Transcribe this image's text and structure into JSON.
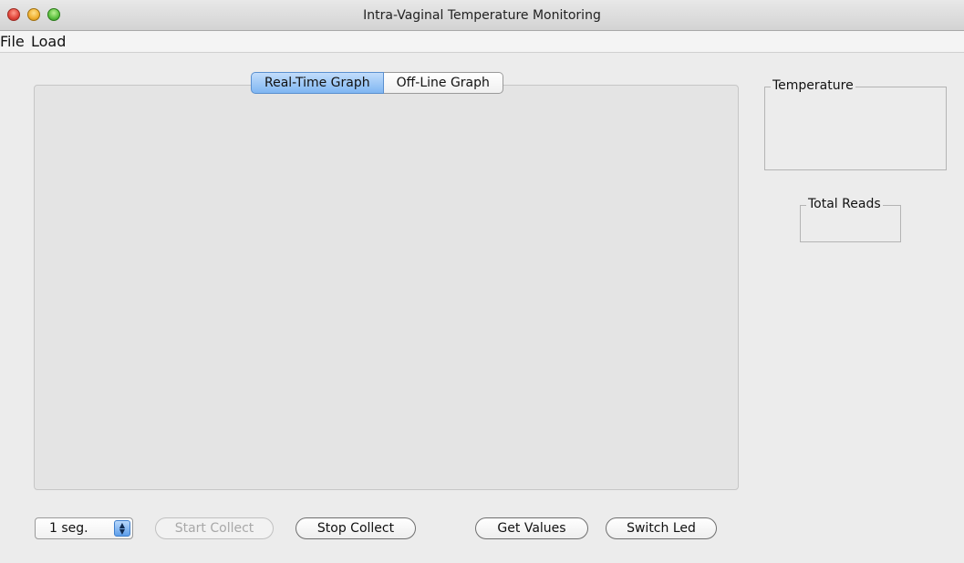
{
  "window": {
    "title": "Intra-Vaginal Temperature Monitoring"
  },
  "menubar": {
    "items": [
      "File",
      "Load"
    ]
  },
  "tabs": [
    {
      "label": "Real-Time Graph",
      "selected": true
    },
    {
      "label": "Off-Line Graph",
      "selected": false
    }
  ],
  "panels": {
    "temperature": {
      "label": "Temperature",
      "value": ""
    },
    "total_reads": {
      "label": "Total Reads",
      "value": ""
    }
  },
  "controls": {
    "interval_spinner": {
      "value": "1  seg."
    },
    "start_collect": {
      "label": "Start Collect",
      "enabled": false
    },
    "stop_collect": {
      "label": "Stop Collect",
      "enabled": true
    },
    "get_values": {
      "label": "Get Values",
      "enabled": true
    },
    "switch_led": {
      "label": "Switch Led",
      "enabled": true
    }
  },
  "colors": {
    "tab_selected": "#7fb6f2",
    "window_bg": "#ececec",
    "graph_bg": "#e4e4e4"
  }
}
